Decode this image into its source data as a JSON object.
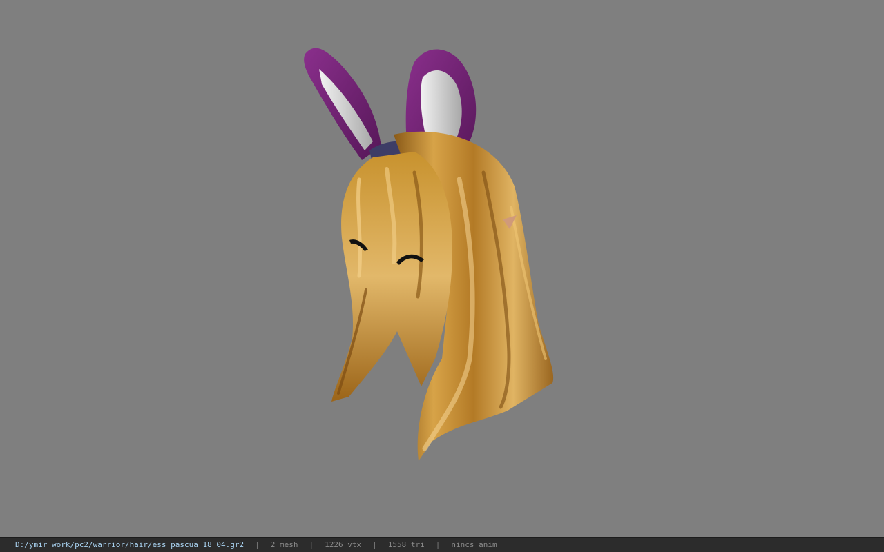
{
  "viewport": {
    "background_color": "#7f7f7f",
    "model": {
      "hair_color": "#c8922e",
      "ears_outer_color": "#6e2170",
      "ears_inner_color": "#d9d9d9"
    }
  },
  "status_bar": {
    "file_path": "D:/ymir work/pc2/warrior/hair/ess_pascua_18_04.gr2",
    "separator": "|",
    "mesh_count": "2 mesh",
    "vertex_count": "1226 vtx",
    "triangle_count": "1558 tri",
    "animation_status": "nincs anim"
  }
}
